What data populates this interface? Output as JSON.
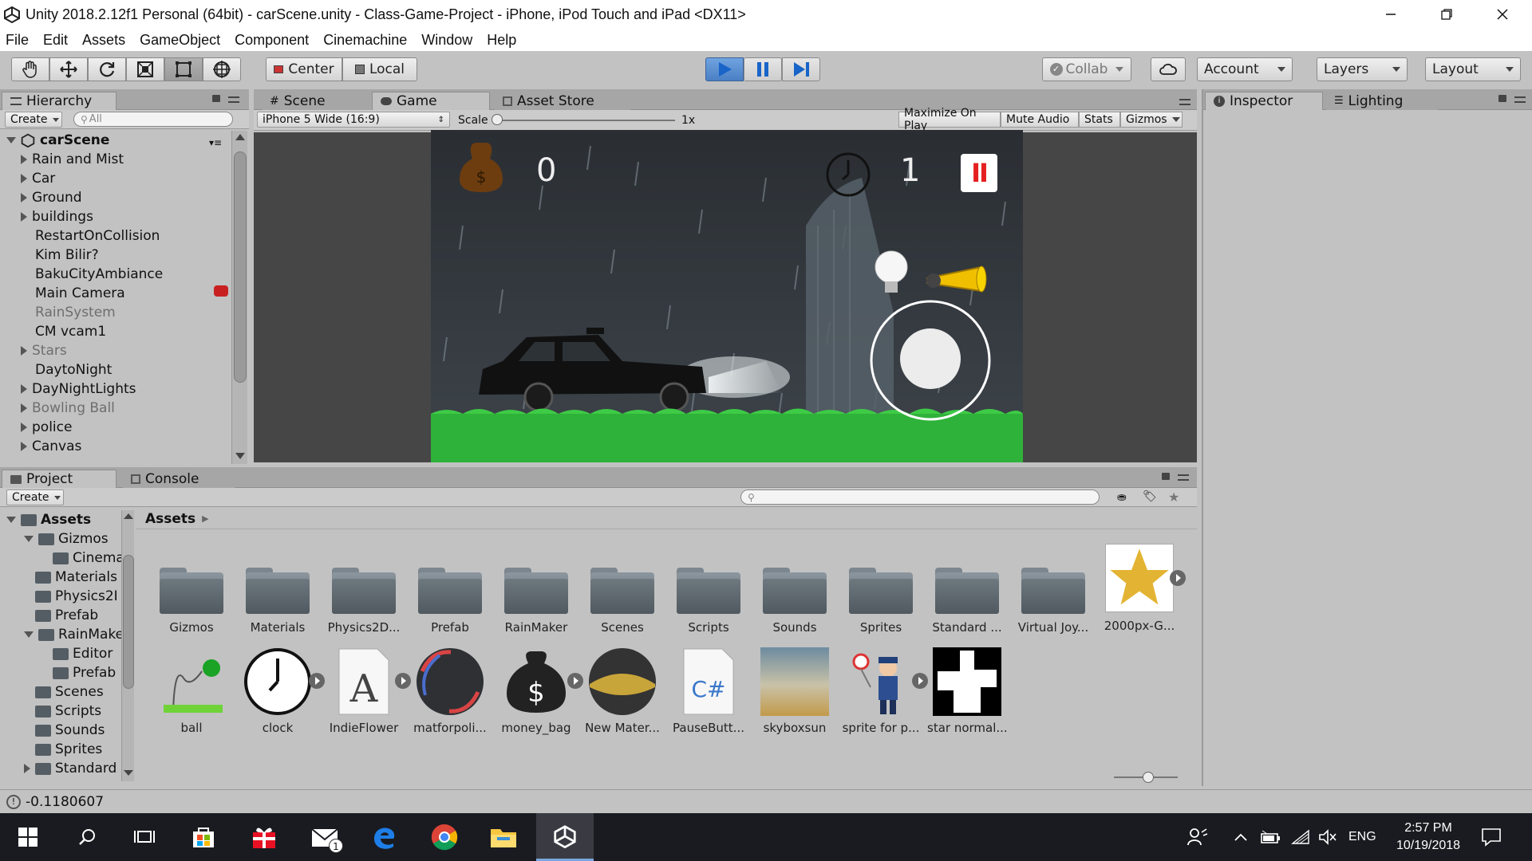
{
  "window": {
    "title": "Unity 2018.2.12f1 Personal (64bit) - carScene.unity - Class-Game-Project - iPhone, iPod Touch and iPad <DX11>",
    "controls": [
      "minimize",
      "restore",
      "close"
    ]
  },
  "menu": [
    "File",
    "Edit",
    "Assets",
    "GameObject",
    "Component",
    "Cinemachine",
    "Window",
    "Help"
  ],
  "toolbar": {
    "tools": [
      "hand-tool",
      "move-tool",
      "rotate-tool",
      "scale-tool",
      "rect-tool",
      "transform-tool"
    ],
    "active_tool": "rect-tool",
    "pivot_label": "Center",
    "space_label": "Local",
    "play_state": "playing",
    "collab_label": "Collab",
    "account_label": "Account",
    "layers_label": "Layers",
    "layout_label": "Layout"
  },
  "hierarchy": {
    "tab_label": "Hierarchy",
    "create_label": "Create",
    "search_placeholder": "All",
    "scene_name": "carScene",
    "items": [
      {
        "label": "Rain and Mist",
        "expandable": true,
        "disabled": false
      },
      {
        "label": "Car",
        "expandable": true,
        "disabled": false
      },
      {
        "label": "Ground",
        "expandable": true,
        "disabled": false
      },
      {
        "label": "buildings",
        "expandable": true,
        "disabled": false
      },
      {
        "label": "RestartOnCollision",
        "expandable": false,
        "disabled": false
      },
      {
        "label": "Kim Bilir?",
        "expandable": false,
        "disabled": false
      },
      {
        "label": "BakuCityAmbiance",
        "expandable": false,
        "disabled": false
      },
      {
        "label": "Main Camera",
        "expandable": false,
        "disabled": false
      },
      {
        "label": "RainSystem",
        "expandable": false,
        "disabled": true
      },
      {
        "label": "CM vcam1",
        "expandable": false,
        "disabled": false
      },
      {
        "label": "Stars",
        "expandable": true,
        "disabled": true
      },
      {
        "label": "DaytoNight",
        "expandable": false,
        "disabled": false
      },
      {
        "label": "DayNightLights",
        "expandable": true,
        "disabled": false
      },
      {
        "label": "Bowling Ball",
        "expandable": true,
        "disabled": true
      },
      {
        "label": "police",
        "expandable": true,
        "disabled": false
      },
      {
        "label": "Canvas",
        "expandable": true,
        "disabled": false
      }
    ]
  },
  "views": {
    "tabs": [
      "Scene",
      "Game",
      "Asset Store"
    ],
    "active_tab": "Game",
    "resolution_label": "iPhone 5 Wide (16:9)",
    "scale_label": "Scale",
    "scale_value": "1x",
    "buttons": [
      "Maximize On Play",
      "Mute Audio",
      "Stats",
      "Gizmos"
    ]
  },
  "game": {
    "money_count": "0",
    "time_count": "1",
    "pause_label": "II"
  },
  "inspector": {
    "tabs": [
      "Inspector",
      "Lighting"
    ]
  },
  "project": {
    "tabs": [
      "Project",
      "Console"
    ],
    "create_label": "Create",
    "breadcrumb": "Assets",
    "tree": [
      {
        "label": "Assets",
        "indent": 0,
        "arrow": "down",
        "bold": true
      },
      {
        "label": "Gizmos",
        "indent": 1,
        "arrow": "down",
        "bold": false
      },
      {
        "label": "Cinema",
        "indent": 2,
        "arrow": "",
        "bold": false
      },
      {
        "label": "Materials",
        "indent": 1,
        "arrow": "",
        "bold": false
      },
      {
        "label": "Physics2I",
        "indent": 1,
        "arrow": "",
        "bold": false
      },
      {
        "label": "Prefab",
        "indent": 1,
        "arrow": "",
        "bold": false
      },
      {
        "label": "RainMake",
        "indent": 1,
        "arrow": "down",
        "bold": false
      },
      {
        "label": "Editor",
        "indent": 2,
        "arrow": "",
        "bold": false
      },
      {
        "label": "Prefab",
        "indent": 2,
        "arrow": "",
        "bold": false
      },
      {
        "label": "Scenes",
        "indent": 1,
        "arrow": "",
        "bold": false
      },
      {
        "label": "Scripts",
        "indent": 1,
        "arrow": "",
        "bold": false
      },
      {
        "label": "Sounds",
        "indent": 1,
        "arrow": "",
        "bold": false
      },
      {
        "label": "Sprites",
        "indent": 1,
        "arrow": "",
        "bold": false
      },
      {
        "label": "Standard",
        "indent": 1,
        "arrow": "right",
        "bold": false
      }
    ],
    "folders": [
      "Gizmos",
      "Materials",
      "Physics2D...",
      "Prefab",
      "RainMaker",
      "Scenes",
      "Scripts",
      "Sounds",
      "Sprites",
      "Standard ...",
      "Virtual Joy..."
    ],
    "star_asset": "2000px-G...",
    "assets_row2": [
      {
        "label": "ball",
        "kind": "ball"
      },
      {
        "label": "clock",
        "kind": "clock"
      },
      {
        "label": "IndieFlower",
        "kind": "font"
      },
      {
        "label": "matforpoli...",
        "kind": "material"
      },
      {
        "label": "money_bag",
        "kind": "moneybag"
      },
      {
        "label": "New Mater...",
        "kind": "newmat"
      },
      {
        "label": "PauseButt...",
        "kind": "script"
      },
      {
        "label": "skyboxsun",
        "kind": "skybox"
      },
      {
        "label": "sprite for p...",
        "kind": "police"
      },
      {
        "label": "star normal...",
        "kind": "starnormal"
      }
    ]
  },
  "status": {
    "message": "-0.1180607"
  },
  "taskbar": {
    "language": "ENG",
    "time": "2:57 PM",
    "date": "10/19/2018",
    "mail_badge": "1"
  }
}
